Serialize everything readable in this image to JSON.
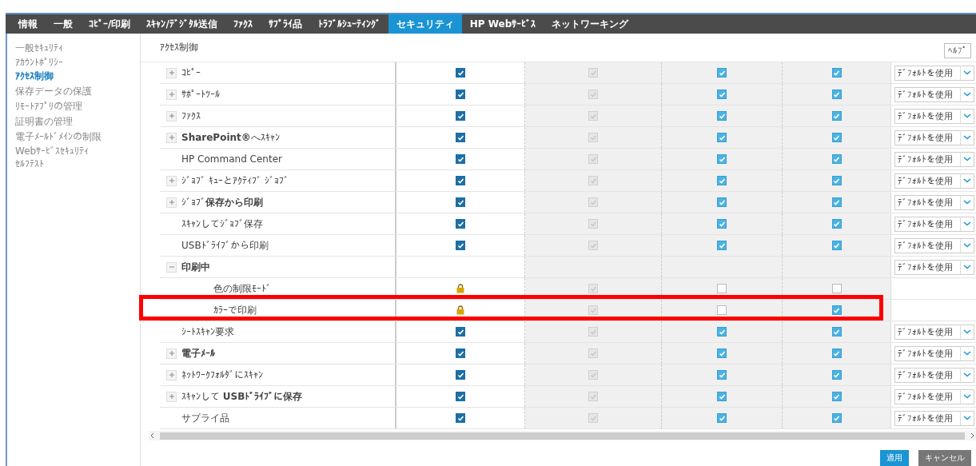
{
  "tabs": [
    {
      "label": "情報",
      "selected": false
    },
    {
      "label": "一般",
      "selected": false
    },
    {
      "label": "ｺﾋﾟｰ/印刷",
      "selected": false
    },
    {
      "label": "ｽｷｬﾝ/ﾃﾞｼﾞﾀﾙ送信",
      "selected": false
    },
    {
      "label": "ﾌｧｸｽ",
      "selected": false
    },
    {
      "label": "ｻﾌﾟﾗｲ品",
      "selected": false
    },
    {
      "label": "ﾄﾗﾌﾞﾙｼｭｰﾃｨﾝｸﾞ",
      "selected": false
    },
    {
      "label": "セキュリティ",
      "selected": true
    },
    {
      "label": "HP Webｻｰﾋﾞｽ",
      "selected": false
    },
    {
      "label": "ネットワーキング",
      "selected": false
    }
  ],
  "sidebar": {
    "items": [
      {
        "label": "一般ｾｷｭﾘﾃｨ",
        "selected": false
      },
      {
        "label": "ｱｶｳﾝﾄﾎﾟﾘｼｰ",
        "selected": false
      },
      {
        "label": "ｱｸｾｽ制御",
        "selected": true
      },
      {
        "label": "保存データの保護",
        "selected": false
      },
      {
        "label": "ﾘﾓｰﾄｱﾌﾟﾘの管理",
        "selected": false
      },
      {
        "label": "証明書の管理",
        "selected": false
      },
      {
        "label": "電子ﾒｰﾙﾄﾞﾒｲﾝの制限",
        "selected": false
      },
      {
        "label": "Webｻｰﾋﾞｽｾｷｭﾘﾃｨ",
        "selected": false
      },
      {
        "label": "ｾﾙﾌﾃｽﾄ",
        "selected": false
      }
    ]
  },
  "page": {
    "title": "ｱｸｾｽ制御",
    "help_button": "ﾍﾙﾌﾟ"
  },
  "table": {
    "rows": [
      {
        "label": "ｺﾋﾟｰ",
        "bold": false,
        "expanded": false,
        "highlighted": false,
        "cells": [
          {
            "kind": "checkbox",
            "checked": true,
            "disabled": false
          },
          {
            "kind": "checkbox",
            "checked": true,
            "disabled": true
          },
          {
            "kind": "checkbox",
            "checked": true,
            "disabled": false
          },
          {
            "kind": "checkbox",
            "checked": true,
            "disabled": false
          }
        ],
        "select": "ﾃﾞﾌｫﾙﾄを使用"
      },
      {
        "label": "ｻﾎﾟｰﾄﾂｰﾙ",
        "bold": false,
        "expanded": false,
        "highlighted": false,
        "cells": [
          {
            "kind": "checkbox",
            "checked": true,
            "disabled": false
          },
          {
            "kind": "checkbox",
            "checked": true,
            "disabled": true
          },
          {
            "kind": "checkbox",
            "checked": true,
            "disabled": false
          },
          {
            "kind": "checkbox",
            "checked": true,
            "disabled": false
          }
        ],
        "select": "ﾃﾞﾌｫﾙﾄを使用"
      },
      {
        "label": "ﾌｧｸｽ",
        "bold": false,
        "expanded": false,
        "highlighted": false,
        "cells": [
          {
            "kind": "checkbox",
            "checked": true,
            "disabled": false
          },
          {
            "kind": "checkbox",
            "checked": true,
            "disabled": true
          },
          {
            "kind": "checkbox",
            "checked": true,
            "disabled": false
          },
          {
            "kind": "checkbox",
            "checked": true,
            "disabled": false
          }
        ],
        "select": "ﾃﾞﾌｫﾙﾄを使用"
      },
      {
        "label": "**SharePoint®**へｽｷｬﾝ",
        "bold": false,
        "expanded": false,
        "highlighted": false,
        "cells": [
          {
            "kind": "checkbox",
            "checked": true,
            "disabled": false
          },
          {
            "kind": "checkbox",
            "checked": true,
            "disabled": true
          },
          {
            "kind": "checkbox",
            "checked": true,
            "disabled": false
          },
          {
            "kind": "checkbox",
            "checked": true,
            "disabled": false
          }
        ],
        "select": "ﾃﾞﾌｫﾙﾄを使用"
      },
      {
        "label": "HP Command Center",
        "bold": false,
        "highlighted": false,
        "cells": [
          {
            "kind": "checkbox",
            "checked": true,
            "disabled": false
          },
          {
            "kind": "checkbox",
            "checked": true,
            "disabled": true
          },
          {
            "kind": "checkbox",
            "checked": true,
            "disabled": false
          },
          {
            "kind": "checkbox",
            "checked": true,
            "disabled": false
          }
        ],
        "select": "ﾃﾞﾌｫﾙﾄを使用"
      },
      {
        "label": "ｼﾞｮﾌﾞ ｷｭｰとｱｸﾃｨﾌﾞ ｼﾞｮﾌﾞ",
        "bold": false,
        "expanded": false,
        "highlighted": false,
        "cells": [
          {
            "kind": "checkbox",
            "checked": true,
            "disabled": false
          },
          {
            "kind": "checkbox",
            "checked": true,
            "disabled": true
          },
          {
            "kind": "checkbox",
            "checked": true,
            "disabled": false
          },
          {
            "kind": "checkbox",
            "checked": true,
            "disabled": false
          }
        ],
        "select": "ﾃﾞﾌｫﾙﾄを使用"
      },
      {
        "label": "ｼﾞｮﾌﾞ**保存から印刷**",
        "bold": false,
        "expanded": false,
        "highlighted": false,
        "cells": [
          {
            "kind": "checkbox",
            "checked": true,
            "disabled": false
          },
          {
            "kind": "checkbox",
            "checked": true,
            "disabled": true
          },
          {
            "kind": "checkbox",
            "checked": true,
            "disabled": false
          },
          {
            "kind": "checkbox",
            "checked": true,
            "disabled": false
          }
        ],
        "select": "ﾃﾞﾌｫﾙﾄを使用"
      },
      {
        "label": "ｽｷｬﾝしてｼﾞｮﾌﾞ保存",
        "bold": false,
        "highlighted": false,
        "cells": [
          {
            "kind": "checkbox",
            "checked": true,
            "disabled": false
          },
          {
            "kind": "checkbox",
            "checked": true,
            "disabled": true
          },
          {
            "kind": "checkbox",
            "checked": true,
            "disabled": false
          },
          {
            "kind": "checkbox",
            "checked": true,
            "disabled": false
          }
        ],
        "select": "ﾃﾞﾌｫﾙﾄを使用"
      },
      {
        "label": "USBﾄﾞﾗｲﾌﾞから印刷",
        "bold": false,
        "highlighted": false,
        "cells": [
          {
            "kind": "checkbox",
            "checked": true,
            "disabled": false
          },
          {
            "kind": "checkbox",
            "checked": true,
            "disabled": true
          },
          {
            "kind": "checkbox",
            "checked": true,
            "disabled": false
          },
          {
            "kind": "checkbox",
            "checked": true,
            "disabled": false
          }
        ],
        "select": "ﾃﾞﾌｫﾙﾄを使用"
      },
      {
        "label": "印刷中",
        "bold": true,
        "expanded": true,
        "highlighted": false,
        "select": "ﾃﾞﾌｫﾙﾄを使用",
        "children": [
          {
            "label": "色の制限ﾓｰﾄﾞ",
            "bold": false,
            "highlighted": false,
            "cells": [
              {
                "kind": "lock"
              },
              {
                "kind": "checkbox",
                "checked": true,
                "disabled": true
              },
              {
                "kind": "checkbox",
                "checked": false,
                "disabled": false
              },
              {
                "kind": "checkbox",
                "checked": false,
                "disabled": false
              }
            ]
          },
          {
            "label": "ｶﾗｰで印刷",
            "bold": false,
            "highlighted": true,
            "cells": [
              {
                "kind": "lock"
              },
              {
                "kind": "checkbox",
                "checked": true,
                "disabled": true
              },
              {
                "kind": "checkbox",
                "checked": false,
                "disabled": false
              },
              {
                "kind": "checkbox",
                "checked": true,
                "disabled": false
              }
            ]
          }
        ]
      },
      {
        "label": "ｼｰﾄｽｷｬﾝ要求",
        "bold": false,
        "highlighted": false,
        "cells": [
          {
            "kind": "checkbox",
            "checked": true,
            "disabled": false
          },
          {
            "kind": "checkbox",
            "checked": true,
            "disabled": true
          },
          {
            "kind": "checkbox",
            "checked": true,
            "disabled": false
          },
          {
            "kind": "checkbox",
            "checked": true,
            "disabled": false
          }
        ],
        "select": "ﾃﾞﾌｫﾙﾄを使用"
      },
      {
        "label": "電子ﾒｰﾙ",
        "bold": true,
        "expanded": false,
        "highlighted": false,
        "cells": [
          {
            "kind": "checkbox",
            "checked": true,
            "disabled": false
          },
          {
            "kind": "checkbox",
            "checked": true,
            "disabled": true
          },
          {
            "kind": "checkbox",
            "checked": true,
            "disabled": false
          },
          {
            "kind": "checkbox",
            "checked": true,
            "disabled": false
          }
        ],
        "select": "ﾃﾞﾌｫﾙﾄを使用"
      },
      {
        "label": "ﾈｯﾄﾜｰｸﾌｫﾙﾀﾞにｽｷｬﾝ",
        "bold": false,
        "expanded": false,
        "highlighted": false,
        "cells": [
          {
            "kind": "checkbox",
            "checked": true,
            "disabled": false
          },
          {
            "kind": "checkbox",
            "checked": true,
            "disabled": true
          },
          {
            "kind": "checkbox",
            "checked": true,
            "disabled": false
          },
          {
            "kind": "checkbox",
            "checked": true,
            "disabled": false
          }
        ],
        "select": "ﾃﾞﾌｫﾙﾄを使用"
      },
      {
        "label": "ｽｷｬﾝして **USBﾄﾞﾗｲﾌﾞに保存**",
        "bold": false,
        "expanded": false,
        "highlighted": false,
        "cells": [
          {
            "kind": "checkbox",
            "checked": true,
            "disabled": false
          },
          {
            "kind": "checkbox",
            "checked": true,
            "disabled": true
          },
          {
            "kind": "checkbox",
            "checked": true,
            "disabled": false
          },
          {
            "kind": "checkbox",
            "checked": true,
            "disabled": false
          }
        ],
        "select": "ﾃﾞﾌｫﾙﾄを使用"
      },
      {
        "label": "サプライ品",
        "bold": false,
        "highlighted": false,
        "cells": [
          {
            "kind": "checkbox",
            "checked": true,
            "disabled": false
          },
          {
            "kind": "checkbox",
            "checked": true,
            "disabled": true
          },
          {
            "kind": "checkbox",
            "checked": true,
            "disabled": false
          },
          {
            "kind": "checkbox",
            "checked": true,
            "disabled": false
          }
        ],
        "select": "ﾃﾞﾌｫﾙﾄを使用"
      }
    ]
  },
  "buttons": [
    {
      "kind": "primary",
      "label": "適用"
    },
    {
      "kind": "secondary",
      "label": "キャンセル"
    }
  ]
}
